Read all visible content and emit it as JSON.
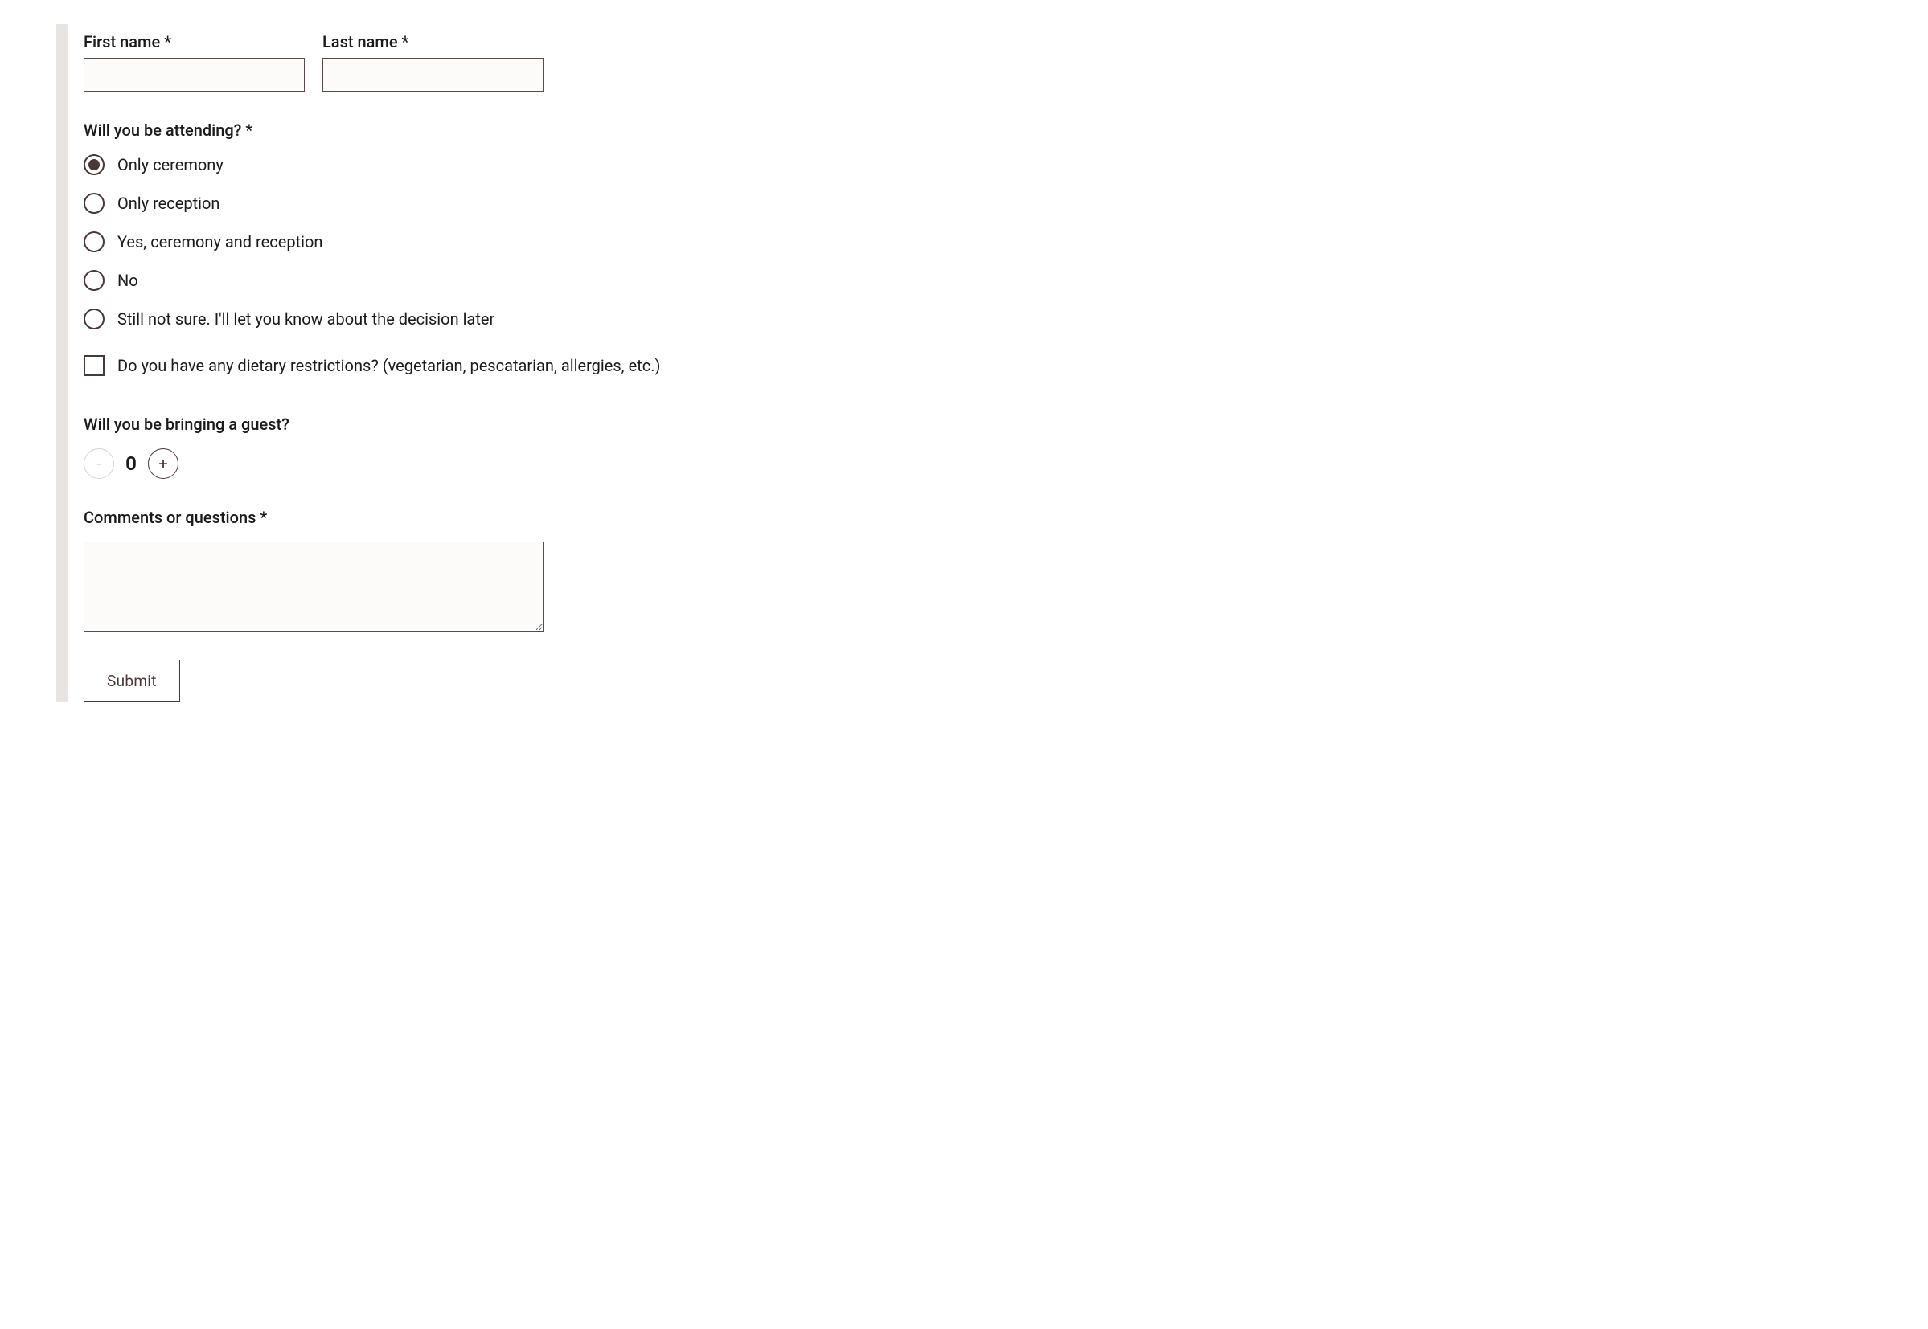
{
  "name": {
    "first_label": "First name *",
    "last_label": "Last name *",
    "first_value": "",
    "last_value": ""
  },
  "attending": {
    "label": "Will you be attending? *",
    "options": [
      {
        "label": "Only ceremony",
        "selected": true
      },
      {
        "label": "Only reception",
        "selected": false
      },
      {
        "label": "Yes, ceremony and reception",
        "selected": false
      },
      {
        "label": "No",
        "selected": false
      },
      {
        "label": "Still not sure. I'll let you know about the decision later",
        "selected": false
      }
    ]
  },
  "dietary": {
    "label": "Do you have any dietary restrictions? (vegetarian, pescatarian, allergies, etc.)",
    "checked": false
  },
  "guest": {
    "label": "Will you be bringing a guest?",
    "value": "0",
    "minus": "-",
    "plus": "+"
  },
  "comments": {
    "label": "Comments or questions *",
    "value": ""
  },
  "submit_label": "Submit"
}
